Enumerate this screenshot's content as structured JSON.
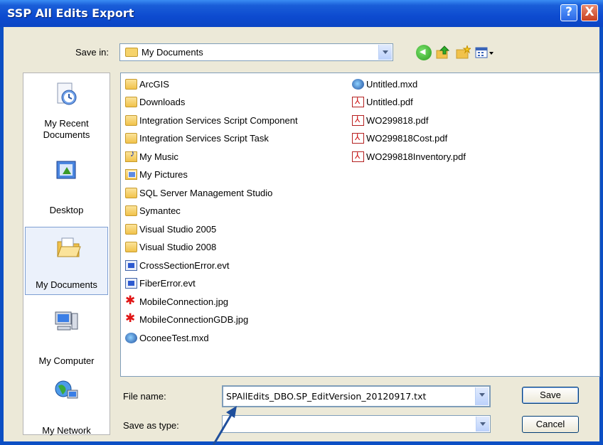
{
  "window": {
    "title": "SSP All Edits Export"
  },
  "title_buttons": {
    "help": "?",
    "close": "X"
  },
  "toolbar": {
    "save_in_label": "Save in:",
    "save_in_value": "My Documents"
  },
  "places": [
    {
      "label1": "My Recent",
      "label2": "Documents"
    },
    {
      "label1": "Desktop",
      "label2": ""
    },
    {
      "label1": "My Documents",
      "label2": ""
    },
    {
      "label1": "My Computer",
      "label2": ""
    },
    {
      "label1": "My Network",
      "label2": ""
    }
  ],
  "files": {
    "col1": [
      {
        "name": "ArcGIS",
        "icon": "folder-icon"
      },
      {
        "name": "Downloads",
        "icon": "folder-icon"
      },
      {
        "name": "Integration Services Script Component",
        "icon": "folder-icon"
      },
      {
        "name": "Integration Services Script Task",
        "icon": "folder-icon"
      },
      {
        "name": "My Music",
        "icon": "music-folder-icon"
      },
      {
        "name": "My Pictures",
        "icon": "pictures-folder-icon"
      },
      {
        "name": "SQL Server Management Studio",
        "icon": "folder-icon"
      },
      {
        "name": "Symantec",
        "icon": "folder-icon"
      },
      {
        "name": "Visual Studio 2005",
        "icon": "folder-icon"
      },
      {
        "name": "Visual Studio 2008",
        "icon": "folder-icon"
      },
      {
        "name": "CrossSectionError.evt",
        "icon": "evt-file-icon"
      },
      {
        "name": "FiberError.evt",
        "icon": "evt-file-icon"
      },
      {
        "name": "MobileConnection.jpg",
        "icon": "jpg-file-icon"
      },
      {
        "name": "MobileConnectionGDB.jpg",
        "icon": "jpg-file-icon"
      },
      {
        "name": "OconeeTest.mxd",
        "icon": "mxd-file-icon"
      }
    ],
    "col2": [
      {
        "name": "Untitled.mxd",
        "icon": "mxd-file-icon"
      },
      {
        "name": "Untitled.pdf",
        "icon": "pdf-file-icon"
      },
      {
        "name": "WO299818.pdf",
        "icon": "pdf-file-icon"
      },
      {
        "name": "WO299818Cost.pdf",
        "icon": "pdf-file-icon"
      },
      {
        "name": "WO299818Inventory.pdf",
        "icon": "pdf-file-icon"
      }
    ]
  },
  "form": {
    "file_name_label": "File name:",
    "file_name_value": "SPAllEdits_DBO.SP_EditVersion_20120917.txt",
    "save_as_type_label": "Save as type:",
    "save_as_type_value": ""
  },
  "buttons": {
    "save": "Save",
    "cancel": "Cancel"
  }
}
